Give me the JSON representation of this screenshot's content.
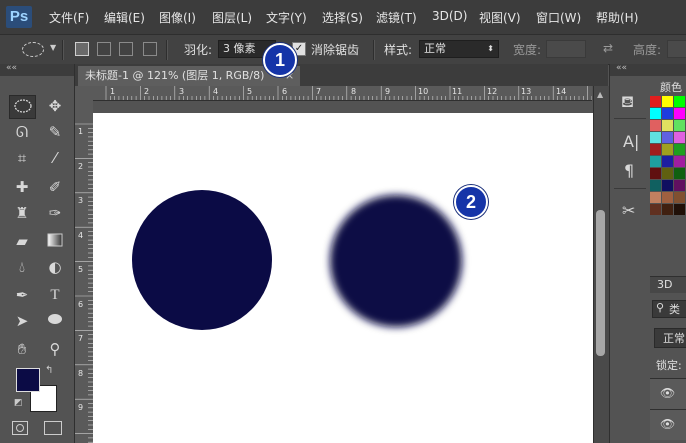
{
  "app": {
    "logo": "Ps"
  },
  "menu": [
    "文件(F)",
    "编辑(E)",
    "图像(I)",
    "图层(L)",
    "文字(Y)",
    "选择(S)",
    "滤镜(T)",
    "3D(D)",
    "视图(V)",
    "窗口(W)",
    "帮助(H)"
  ],
  "options": {
    "feather_label": "羽化:",
    "feather_value": "3 像素",
    "antialias_label": "消除锯齿",
    "style_label": "样式:",
    "style_value": "正常",
    "width_label": "宽度:",
    "height_label": "高度:"
  },
  "document": {
    "tab_title": "未标题-1 @ 121% (图层 1, RGB/8)",
    "close_glyph": "×",
    "ruler_h": [
      "1",
      "2",
      "3",
      "4",
      "5",
      "6",
      "7",
      "8",
      "9",
      "10",
      "11",
      "12",
      "13",
      "14"
    ],
    "ruler_v": [
      "1",
      "2",
      "3",
      "4",
      "5",
      "6",
      "7",
      "8",
      "9"
    ]
  },
  "shapes": {
    "circle_color": "#0b0b45"
  },
  "annotations": {
    "badge1": "1",
    "badge2": "2"
  },
  "right_panel": {
    "color_tab": "颜色",
    "tab_3d": "3D",
    "layers_kind": "类",
    "blend_mode": "正常",
    "lock_label": "锁定:"
  },
  "swatches": [
    "#e01e1e",
    "#ffff00",
    "#00ff00",
    "#00ffff",
    "#1e3ce0",
    "#ff00ff",
    "#e06060",
    "#e0e060",
    "#60e060",
    "#60e0e0",
    "#6060e0",
    "#e060e0",
    "#a01e1e",
    "#a0a01e",
    "#1ea01e",
    "#1ea0a0",
    "#1e1ea0",
    "#a01ea0",
    "#601010",
    "#606010",
    "#106010",
    "#106060",
    "#101060",
    "#601060",
    "#c08060",
    "#a06040",
    "#805030",
    "#603020",
    "#402010",
    "#201008"
  ],
  "colors": {
    "foreground": "#0b0b45",
    "background": "#ffffff",
    "badge": "#1534a8"
  }
}
